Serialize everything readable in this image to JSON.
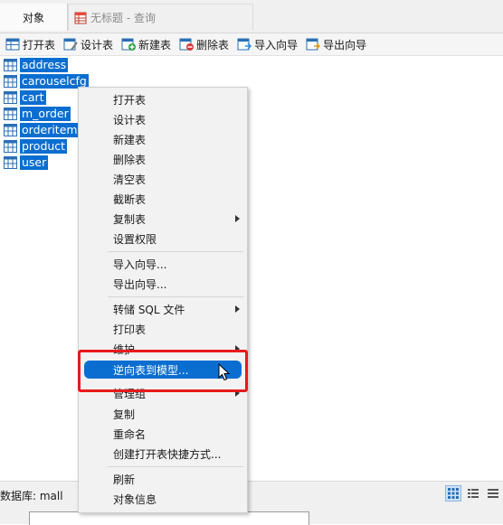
{
  "tabs": {
    "objects_label": "对象",
    "query_label": "无标题 - 查询"
  },
  "toolbar": {
    "open_table": "打开表",
    "design_table": "设计表",
    "new_table": "新建表",
    "delete_table": "删除表",
    "import_wizard": "导入向导",
    "export_wizard": "导出向导"
  },
  "tables": [
    "address",
    "carouselcfg",
    "cart",
    "m_order",
    "orderitem",
    "product",
    "user"
  ],
  "context_menu": {
    "items": [
      {
        "label": "打开表"
      },
      {
        "label": "设计表"
      },
      {
        "label": "新建表"
      },
      {
        "label": "删除表"
      },
      {
        "label": "清空表"
      },
      {
        "label": "截断表"
      },
      {
        "label": "复制表",
        "submenu": true
      },
      {
        "label": "设置权限"
      },
      {
        "label": "导入向导..."
      },
      {
        "label": "导出向导..."
      },
      {
        "label": "转储 SQL 文件",
        "submenu": true
      },
      {
        "label": "打印表"
      },
      {
        "label": "维护",
        "submenu": true
      },
      {
        "label": "逆向表到模型...",
        "highlighted": true
      },
      {
        "label": "管理组",
        "submenu": true
      },
      {
        "label": "复制"
      },
      {
        "label": "重命名"
      },
      {
        "label": "创建打开表快捷方式..."
      },
      {
        "label": "刷新"
      },
      {
        "label": "对象信息"
      }
    ]
  },
  "status": {
    "database": "数据库: mall"
  },
  "colors": {
    "selection": "#0a6ed1",
    "annotation": "#e8191c"
  }
}
